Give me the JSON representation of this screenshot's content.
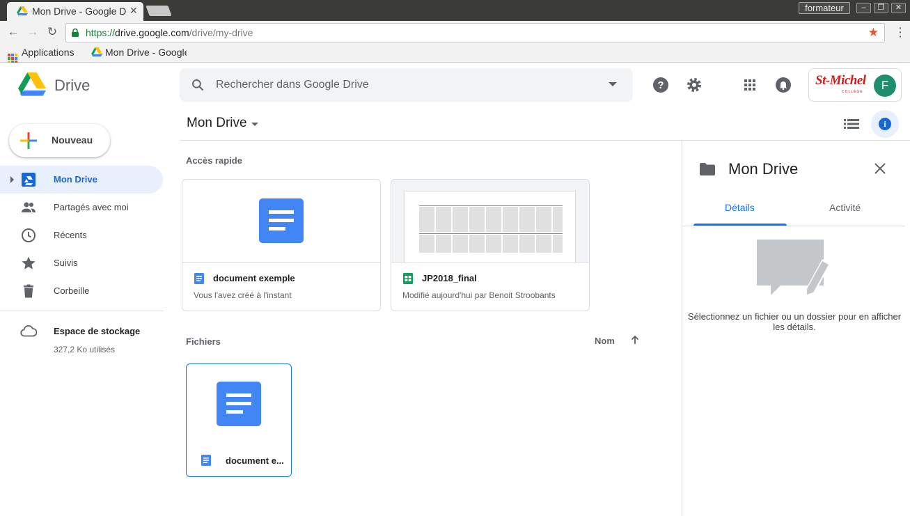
{
  "browser": {
    "tab_title": "Mon Drive - Google Drive",
    "tab_close_icon": "close-icon",
    "profile_name": "formateur",
    "url_scheme": "https://",
    "url_host": "drive.google.com",
    "url_path": "/drive/my-drive",
    "bookmarks": [
      {
        "label": "Applications",
        "icon": "apps-grid-icon"
      },
      {
        "label": "Mon Drive - Google Drive",
        "icon": "drive-icon"
      }
    ]
  },
  "app": {
    "name": "Drive",
    "search_placeholder": "Rechercher dans Google Drive",
    "account_logo_text": "St-Michel",
    "account_logo_sub": "COLLÈGE",
    "avatar_initial": "F",
    "new_button": "Nouveau",
    "breadcrumb": "Mon Drive"
  },
  "sidebar": {
    "items": [
      {
        "label": "Mon Drive",
        "icon": "my-drive-icon",
        "active": true
      },
      {
        "label": "Partagés avec moi",
        "icon": "people-icon",
        "active": false
      },
      {
        "label": "Récents",
        "icon": "clock-icon",
        "active": false
      },
      {
        "label": "Suivis",
        "icon": "star-icon",
        "active": false
      },
      {
        "label": "Corbeille",
        "icon": "trash-icon",
        "active": false
      }
    ],
    "storage_title": "Espace de stockage",
    "storage_used": "327,2 Ko utilisés"
  },
  "main": {
    "quick_access_title": "Accès rapide",
    "quick_access": [
      {
        "name": "document exemple",
        "subtitle": "Vous l'avez créé à l'instant",
        "type": "doc"
      },
      {
        "name": "JP2018_final",
        "subtitle": "Modifié aujourd'hui par Benoit Stroobants",
        "type": "sheet"
      }
    ],
    "files_title": "Fichiers",
    "sort_label": "Nom",
    "files": [
      {
        "name": "document e...",
        "type": "doc"
      }
    ]
  },
  "details": {
    "title": "Mon Drive",
    "tabs": [
      "Détails",
      "Activité"
    ],
    "active_tab": "Détails",
    "empty_message": "Sélectionnez un fichier ou un dossier pour en afficher les détails."
  },
  "colors": {
    "accent": "#1a73e8",
    "doc_blue": "#4285f4",
    "sheet_green": "#0f9d58",
    "avatar": "#1e8e6e"
  }
}
